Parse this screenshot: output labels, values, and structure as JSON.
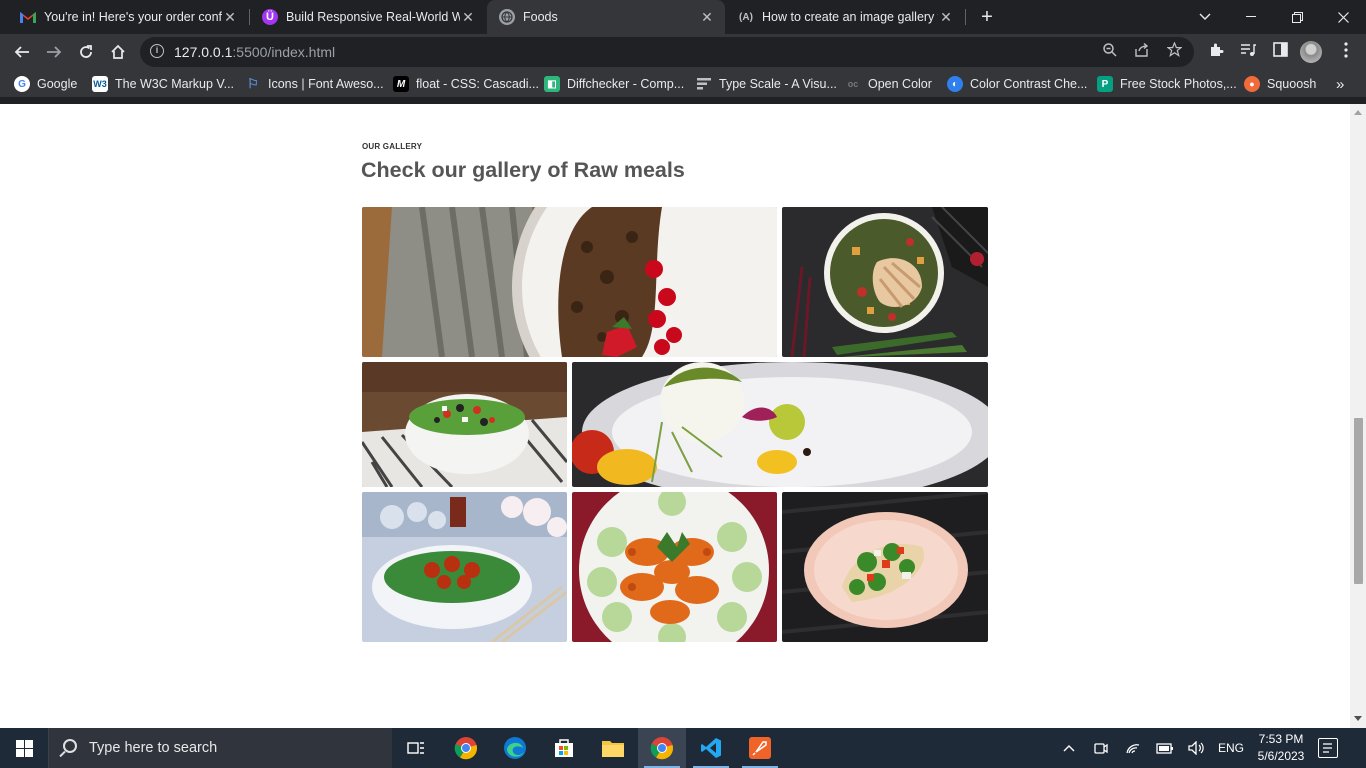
{
  "browser": {
    "tabs": [
      {
        "title": "You're in! Here's your order confi",
        "icon": "gmail-icon",
        "active": false
      },
      {
        "title": "Build Responsive Real-World Web",
        "icon": "udemy-icon",
        "active": false
      },
      {
        "title": "Foods",
        "icon": "globe-icon",
        "active": true
      },
      {
        "title": "How to create an image gallery w",
        "icon": "angular-icon",
        "active": false
      }
    ],
    "url_host": "127.0.0.1",
    "url_path": ":5500/index.html",
    "bookmarks": [
      {
        "label": "Google",
        "icon": "google-icon"
      },
      {
        "label": "The W3C Markup V...",
        "icon": "w3c-icon"
      },
      {
        "label": "Icons | Font Aweso...",
        "icon": "flag-icon"
      },
      {
        "label": "float - CSS: Cascadi...",
        "icon": "mdn-icon"
      },
      {
        "label": "Diffchecker - Comp...",
        "icon": "diffchecker-icon"
      },
      {
        "label": "Type Scale - A Visu...",
        "icon": "typescale-icon"
      },
      {
        "label": "Open Color",
        "icon": "opencolor-icon"
      },
      {
        "label": "Color Contrast Che...",
        "icon": "contrast-icon"
      },
      {
        "label": "Free Stock Photos,...",
        "icon": "pexels-icon"
      },
      {
        "label": "Squoosh",
        "icon": "squoosh-icon"
      }
    ]
  },
  "page": {
    "eyebrow": "Our gallery",
    "heading": "Check our gallery of Raw meals",
    "gallery": [
      {
        "name": "granola-yogurt-bowl"
      },
      {
        "name": "chicken-salad-bowl"
      },
      {
        "name": "greek-salad-bowl"
      },
      {
        "name": "burrata-plate"
      },
      {
        "name": "cucumber-chicken-bowl"
      },
      {
        "name": "shrimp-plate"
      },
      {
        "name": "salad-wrap-plate"
      }
    ]
  },
  "taskbar": {
    "search_placeholder": "Type here to search",
    "language": "ENG",
    "time": "7:53 PM",
    "date": "5/6/2023"
  },
  "colors": {
    "accent": "#7fb2e5",
    "heading": "#555555"
  }
}
